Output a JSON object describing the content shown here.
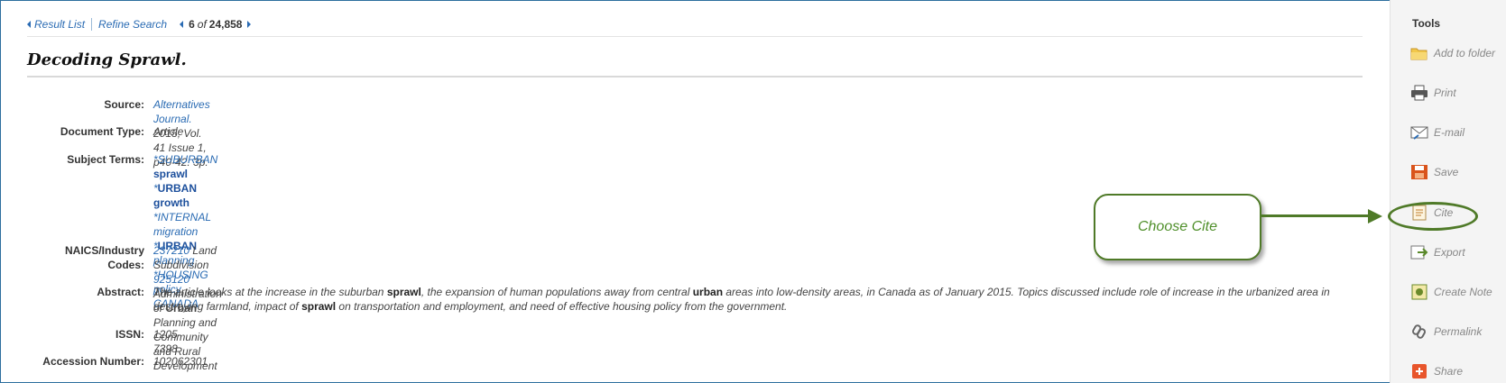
{
  "nav": {
    "result_list": "Result List",
    "refine_search": "Refine Search",
    "current": "6",
    "of": "of",
    "total": "24,858"
  },
  "record": {
    "title": "Decoding Sprawl.",
    "source_label": "Source:",
    "source_link": "Alternatives Journal.",
    "source_rest": " 2015, Vol. 41 Issue 1, p40-42. 3p.",
    "doctype_label": "Document Type:",
    "doctype_value": "Article",
    "subjects_label": "Subject Terms:",
    "subjects": [
      {
        "prefix": "*",
        "a": "SUBURBAN",
        "b": "sprawl",
        "bold_part": "b"
      },
      {
        "prefix": "*",
        "a": "URBAN",
        "b": "growth",
        "bold_part": "both"
      },
      {
        "prefix": "*",
        "a": "INTERNAL migration",
        "b": "",
        "bold_part": "none"
      },
      {
        "prefix": "*",
        "a": "URBAN",
        "b": "planning",
        "bold_part": "a"
      },
      {
        "prefix": "*",
        "a": "HOUSING policy",
        "b": "",
        "bold_part": "none"
      },
      {
        "prefix": "",
        "a": "CANADA",
        "b": "",
        "bold_part": "none"
      }
    ],
    "naics_label_1": "NAICS/Industry",
    "naics_label_2": "Codes:",
    "naics": [
      {
        "code": "237210",
        "desc_a": "Land Subdivision",
        "desc_b": "",
        "desc_c": ""
      },
      {
        "code": "925120",
        "desc_a": "Administration of",
        "desc_b": "Urban",
        "desc_c": "Planning and Community and Rural Development"
      }
    ],
    "abstract_label": "Abstract:",
    "abstract_parts": [
      "The article looks at the increase in the suburban ",
      "sprawl",
      ", the expansion of human populations away from central ",
      "urban",
      " areas into low-density areas, in Canada as of January 2015. Topics discussed include role of increase in the urbanized area in destroying farmland, impact of ",
      "sprawl",
      " on transportation and employment, and need of effective housing policy from the government."
    ],
    "issn_label": "ISSN:",
    "issn_value": "1205-7398",
    "accession_label": "Accession Number:",
    "accession_value": "102062301"
  },
  "tools": {
    "title": "Tools",
    "items": [
      {
        "label": "Add to folder",
        "icon": "folder-icon"
      },
      {
        "label": "Print",
        "icon": "printer-icon"
      },
      {
        "label": "E-mail",
        "icon": "email-icon"
      },
      {
        "label": "Save",
        "icon": "save-icon"
      },
      {
        "label": "Cite",
        "icon": "cite-icon"
      },
      {
        "label": "Export",
        "icon": "export-icon"
      },
      {
        "label": "Create Note",
        "icon": "note-icon"
      },
      {
        "label": "Permalink",
        "icon": "link-icon"
      },
      {
        "label": "Share",
        "icon": "share-icon"
      }
    ]
  },
  "callout": {
    "text": "Choose Cite",
    "color": "#4f7a28"
  }
}
